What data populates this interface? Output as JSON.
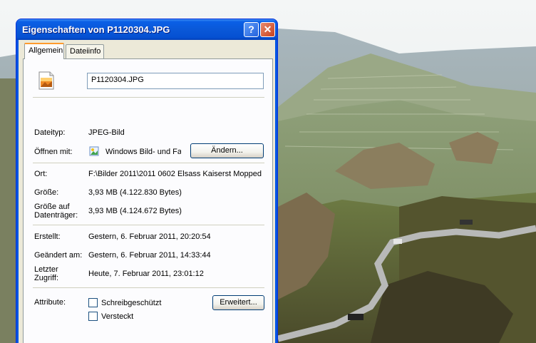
{
  "window": {
    "title": "Eigenschaften von P1120304.JPG",
    "help_label": "?",
    "close_label": "✕"
  },
  "tabs": [
    {
      "label": "Allgemein",
      "active": true
    },
    {
      "label": "Dateiinfo",
      "active": false
    }
  ],
  "general": {
    "file_icon": "jpeg-image-icon",
    "filename": "P1120304.JPG",
    "type_label": "Dateityp:",
    "type_value": "JPEG-Bild",
    "open_with_label": "Öffnen mit:",
    "open_with_icon": "windows-picture-viewer-icon",
    "open_with_value": "Windows Bild- und Fax",
    "change_button": "Ändern...",
    "location_label": "Ort:",
    "location_value": "F:\\Bilder 2011\\2011 0602 Elsass Kaiserst Mopped",
    "size_label": "Größe:",
    "size_value": "3,93 MB (4.122.830 Bytes)",
    "size_on_disk_label_1": "Größe auf",
    "size_on_disk_label_2": "Datenträger:",
    "size_on_disk_value": "3,93 MB (4.124.672 Bytes)",
    "created_label": "Erstellt:",
    "created_value": "Gestern, 6. Februar 2011, 20:20:54",
    "modified_label": "Geändert am:",
    "modified_value": "Gestern, 6. Februar 2011, 14:33:44",
    "accessed_label_1": "Letzter",
    "accessed_label_2": "Zugriff:",
    "accessed_value": "Heute, 7. Februar 2011, 23:01:12",
    "attributes_label": "Attribute:",
    "readonly_label": "Schreibgeschützt",
    "readonly_checked": false,
    "hidden_label": "Versteckt",
    "hidden_checked": false,
    "advanced_button": "Erweitert..."
  },
  "colors": {
    "titlebar": "#0a58d8",
    "dialog_face": "#ece9d8",
    "tab_highlight": "#ff9b2e"
  }
}
